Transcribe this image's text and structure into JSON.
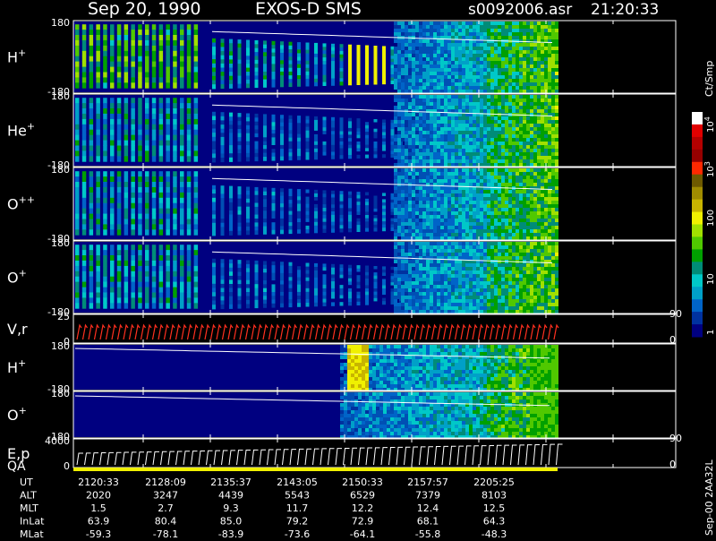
{
  "header": {
    "date": "Sep 20, 1990",
    "instrument": "EXOS-D SMS",
    "filename": "s0092006.asr",
    "time": "21:20:33"
  },
  "colorbar": {
    "unit": "Ct/Smp",
    "ticks": [
      "10",
      "10",
      "100",
      "10",
      "1"
    ],
    "tick_superscripts": [
      "4",
      "3",
      "",
      "",
      ""
    ],
    "colors": [
      "#ffffff",
      "#e10000",
      "#b40000",
      "#960000",
      "#ff2800",
      "#6e5a00",
      "#a08c00",
      "#c8b400",
      "#f0f000",
      "#a0e000",
      "#50c800",
      "#00a000",
      "#008c78",
      "#00c8c8",
      "#00a0c8",
      "#0064c8",
      "#0032a0",
      "#000080"
    ]
  },
  "right_axis_labels": {
    "v_top": "90",
    "v_bottom": "0",
    "e_top": "90",
    "e_bottom": "0"
  },
  "side_label": "Sep-00  2AA32L",
  "panels": [
    {
      "label": "H",
      "sup": "+",
      "ymax": "180",
      "ymin": "-180"
    },
    {
      "label": "He",
      "sup": "+",
      "ymax": "180",
      "ymin": "-180"
    },
    {
      "label": "O",
      "sup": "++",
      "ymax": "180",
      "ymin": "-180"
    },
    {
      "label": "O",
      "sup": "+",
      "ymax": "180",
      "ymin": "-180"
    },
    {
      "label": "V,r",
      "sup": "",
      "ymax": "25",
      "ymin": "0"
    },
    {
      "label": "H",
      "sup": "+",
      "ymax": "180",
      "ymin": "-180"
    },
    {
      "label": "O",
      "sup": "+",
      "ymax": "180",
      "ymin": "-180"
    },
    {
      "label": "E,p",
      "sup": "",
      "ymax": "4000",
      "ymin": "0"
    },
    {
      "label": "QA",
      "sup": "",
      "ymax": "",
      "ymin": ""
    }
  ],
  "chart_data": {
    "type": "heatmap",
    "x_axis_times": [
      "2120:33",
      "2128:09",
      "2135:37",
      "2143:05",
      "2150:33",
      "2157:57",
      "2205:25"
    ],
    "spectrogram_panels": [
      "H+",
      "He+",
      "O++",
      "O+",
      "H+",
      "O+"
    ],
    "ylim_spectrogram": [
      -180,
      180
    ],
    "ylim_velocity": [
      0,
      25
    ],
    "ylim_energy": [
      0,
      4000
    ],
    "colorbar_scale": "log",
    "colorbar_range": [
      1,
      10000
    ]
  },
  "orbit_table": {
    "rows": [
      {
        "name": "UT",
        "values": [
          "2120:33",
          "2128:09",
          "2135:37",
          "2143:05",
          "2150:33",
          "2157:57",
          "2205:25"
        ]
      },
      {
        "name": "ALT",
        "values": [
          "2020",
          "3247",
          "4439",
          "5543",
          "6529",
          "7379",
          "8103"
        ]
      },
      {
        "name": "MLT",
        "values": [
          "1.5",
          "2.7",
          "9.3",
          "11.7",
          "12.2",
          "12.4",
          "12.5"
        ]
      },
      {
        "name": "InLat",
        "values": [
          "63.9",
          "80.4",
          "85.0",
          "79.2",
          "72.9",
          "68.1",
          "64.3"
        ]
      },
      {
        "name": "MLat",
        "values": [
          "-59.3",
          "-78.1",
          "-83.9",
          "-73.6",
          "-64.1",
          "-55.8",
          "-48.3"
        ]
      }
    ]
  }
}
